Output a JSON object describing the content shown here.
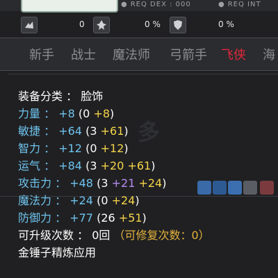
{
  "header": {
    "req_dex": "REQ DEX : 000",
    "req_int": "REQ INT"
  },
  "icon_row": {
    "values": [
      "0",
      "0 %",
      "0 %"
    ]
  },
  "jobs": {
    "items": [
      "新手",
      "战士",
      "魔法师",
      "弓箭手",
      "飞侠",
      "海"
    ],
    "active_index": 4
  },
  "item": {
    "category_label": "装备分类",
    "category_sep": "：",
    "category_value": "脸饰",
    "stats": [
      {
        "label": "力量",
        "sep": "：",
        "total": "+8",
        "base": "0",
        "bonus": [
          "+8"
        ]
      },
      {
        "label": "敏捷",
        "sep": "：",
        "total": "+64",
        "base": "3",
        "bonus": [
          "+61"
        ]
      },
      {
        "label": "智力",
        "sep": "：",
        "total": "+12",
        "base": "0",
        "bonus": [
          "+12"
        ]
      },
      {
        "label": "运气",
        "sep": "：",
        "total": "+84",
        "base": "3",
        "bonus": [
          "+20",
          "+61"
        ]
      },
      {
        "label": "攻击力",
        "sep": "：",
        "total": "+48",
        "base": "3",
        "bonus": [
          "+21",
          "+24"
        ]
      },
      {
        "label": "魔法力",
        "sep": "：",
        "total": "+24",
        "base": "0",
        "bonus": [
          "+24"
        ]
      },
      {
        "label": "防御力",
        "sep": "：",
        "total": "+77",
        "base": "26",
        "bonus": [
          "+51"
        ]
      }
    ],
    "upgrade_label": "可升级次数",
    "upgrade_sep": "：",
    "upgrade_value": "0回",
    "repair_text": "（可修复次数：0）",
    "hammer_text": "金锤子精炼应用"
  },
  "colors": {
    "label_blue": "#6ec3ee",
    "bonus_yellow": "#f5d54a",
    "bonus_purple": "#b58cf2",
    "job_active": "#e0273a",
    "repair_orange": "#e3b23c"
  }
}
